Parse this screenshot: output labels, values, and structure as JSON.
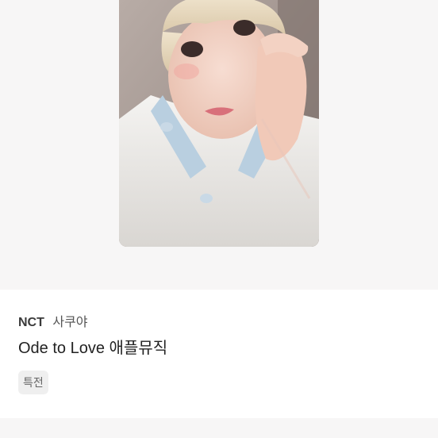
{
  "product": {
    "image_alt": "photocard image",
    "group": "NCT",
    "member": "사쿠야",
    "title": "Ode to Love 애플뮤직",
    "tag": "특전"
  },
  "colors": {
    "image_background": "#f7f6f6",
    "badge_background": "#efefef",
    "title_text": "#222222"
  }
}
